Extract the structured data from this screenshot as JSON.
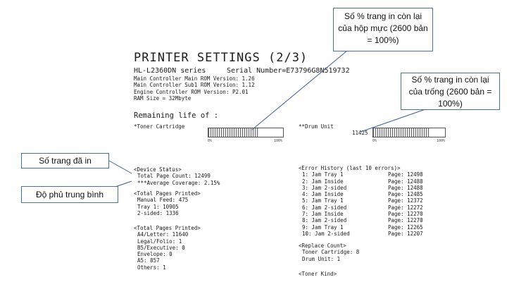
{
  "report": {
    "title": "PRINTER SETTINGS (2/3)",
    "model": "HL-L2360DN series",
    "serial": "Serial Number=E73796G8N519732",
    "versions": [
      "Main Controller Main ROM Version: 1.26",
      "Main Controller Sub1 ROM Version: 1.12",
      "Engine Controller ROM Version: P2.01",
      "RAM Size =  32Mbyte"
    ],
    "remaining_label": "Remaining life of :",
    "toner": {
      "label": "*Toner Cartridge",
      "level_fraction": 0.68,
      "scale_min": "0%",
      "scale_max": "100%"
    },
    "drum": {
      "label": "**Drum Unit",
      "count": "11425",
      "level_fraction": 0.78,
      "scale_min": "0%",
      "scale_max": "100%"
    },
    "device_status": {
      "header": "<Device Status>",
      "rows": [
        "Total Page Count: 12499",
        "***Average Coverage: 2.15%"
      ]
    },
    "total_pages_1": {
      "header": "<Total Pages Printed>",
      "rows": [
        "Manual Feed: 475",
        "Tray 1: 10905",
        "2-sided: 1336"
      ]
    },
    "total_pages_2": {
      "header": "<Total Pages Printed>",
      "rows": [
        "A4/Letter: 11640",
        "Legal/Folio: 1",
        "B5/Executive: 0",
        "Envelope: 0",
        "A5: 857",
        "Others: 1"
      ]
    },
    "error_history": {
      "header": "<Error History (last 10 errors)>",
      "rows": [
        {
          "label": " 1: Jam Tray 1",
          "page": "Page: 12498"
        },
        {
          "label": " 2: Jam Inside",
          "page": "Page: 12488"
        },
        {
          "label": " 3: Jam 2-sided",
          "page": "Page: 12488"
        },
        {
          "label": " 4: Jam Inside",
          "page": "Page: 12485"
        },
        {
          "label": " 5: Jam Tray 1",
          "page": "Page: 12372"
        },
        {
          "label": " 6: Jam 2-sided",
          "page": "Page: 12272"
        },
        {
          "label": " 7: Jam Inside",
          "page": "Page: 12270"
        },
        {
          "label": " 8: Jam 2-sided",
          "page": "Page: 12270"
        },
        {
          "label": " 9: Jam Tray 1",
          "page": "Page: 12265"
        },
        {
          "label": "10: Jam 2-sided",
          "page": "Page: 12207"
        }
      ]
    },
    "replace_count": {
      "header": "<Replace Count>",
      "rows": [
        "Toner Cartridge: 8",
        "Drum Unit: 1"
      ]
    },
    "toner_kind_header": "<Toner Kind>"
  },
  "callouts": {
    "toner_remaining": "Số % trang in còn lại của hộp mực (2600 bản = 100%)",
    "drum_remaining": "Số % trang in còn lại của trống (2600 bản = 100%)",
    "pages_printed": "Số trang đã in",
    "avg_coverage": "Độ phủ trung bình"
  },
  "colors": {
    "callout_border": "#4a6fa5",
    "leader_line": "#3a5f95"
  }
}
